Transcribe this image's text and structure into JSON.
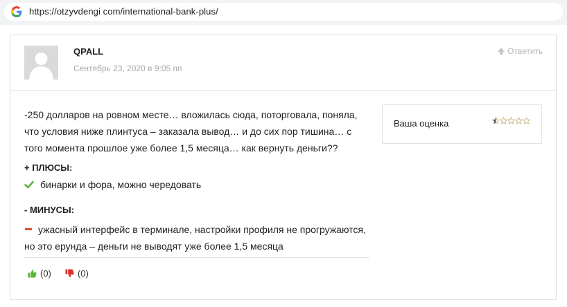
{
  "browser": {
    "url": "https://otzyvdengi com/international-bank-plus/",
    "icon": "google-g-icon"
  },
  "comment": {
    "author": "QPALL",
    "date": "Сентябрь 23, 2020 в 9:05 пп",
    "reply_label": "Ответить",
    "body": "-250 долларов на ровном месте… вложилась сюда, поторговала, поняла, что условия ниже плинтуса – заказала вывод… и до сих пор тишина… с того момента прошлое уже более 1,5 месяца… как вернуть деньги??",
    "pros_title": "+ ПЛЮСЫ:",
    "pros": [
      "бинарки и фора, можно чередовать"
    ],
    "cons_title": "- МИНУСЫ:",
    "cons": [
      "ужасный интерфейс в терминале, настройки профиля не прогружаются, но это ерунда – деньги не выводят уже более 1,5 месяца"
    ],
    "likes": "(0)",
    "dislikes": "(0)",
    "rating_label": "Ваша оценка",
    "rating_value": 0.5,
    "rating_max": 5
  },
  "colors": {
    "check": "#5fb336",
    "minus": "#e14a3c",
    "thumb_up": "#5fb336",
    "thumb_down": "#d9342b",
    "star": "#b8a36a"
  }
}
